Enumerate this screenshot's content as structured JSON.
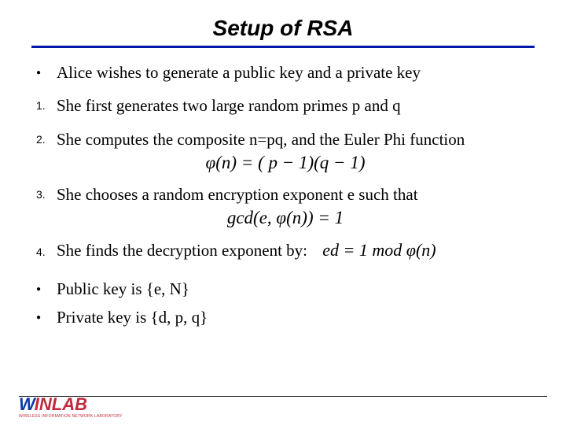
{
  "title": "Setup of RSA",
  "items": [
    {
      "marker": "●",
      "markerClass": "bullet",
      "text": "Alice wishes to generate a public key and a private key"
    },
    {
      "marker": "1.",
      "markerClass": "",
      "text": "She first generates two large random primes p and q"
    },
    {
      "marker": "2.",
      "markerClass": "",
      "text": "She computes the composite n=pq, and the Euler Phi function"
    },
    {
      "marker": "3.",
      "markerClass": "",
      "text": "She chooses a random encryption exponent e such that"
    },
    {
      "marker": "4.",
      "markerClass": "",
      "text": "She finds the decryption exponent by:"
    },
    {
      "marker": "●",
      "markerClass": "bullet",
      "text": "Public key is {e, N}"
    },
    {
      "marker": "●",
      "markerClass": "bullet",
      "text": "Private key is {d, p, q}"
    }
  ],
  "formulas": {
    "phi": "φ(n) = ( p − 1)(q − 1)",
    "gcd": "gcd(e, φ(n)) = 1",
    "ed": "ed = 1  mod φ(n)"
  },
  "logo": {
    "w": "W",
    "inlab": "INLAB",
    "sub": "WIRELESS INFORMATION NETWORK LABORATORY"
  }
}
